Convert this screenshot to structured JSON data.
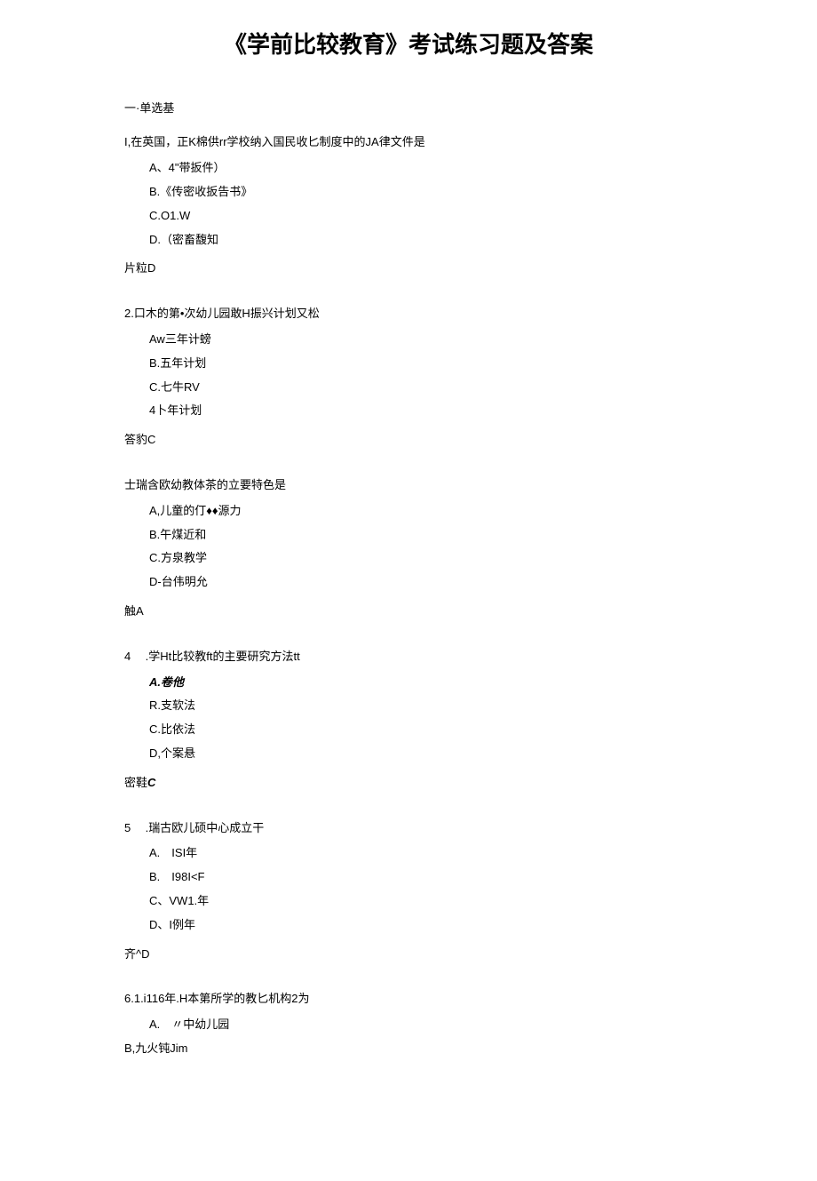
{
  "title": "《学前比较教育》考试练习题及答案",
  "section_heading": "一·单选基",
  "questions": [
    {
      "stem": "I,在英国，正K棉供rr学校纳入国民收匕制度中的JA律文件是",
      "options": [
        "A、4\"带扳件）",
        "B.《传密收扳告书》",
        "C.O1.W",
        "D.（密畜馥知"
      ],
      "answer_label": "片粒",
      "answer_value": "D"
    },
    {
      "stem": "2.口木的第•次幼儿园敢H振兴计划又松",
      "options": [
        "Aw三年计螃",
        "B.五年计划",
        "C.七牛RV",
        "4卜年计划"
      ],
      "answer_label": "答豹",
      "answer_value": "C"
    },
    {
      "stem": "士瑞含欧幼教体茶的立要特色是",
      "options": [
        "A,儿童的仃♦♦源力",
        "B.午煤近和",
        "C.方泉教学",
        "D-台伟明允"
      ],
      "answer_label": "触",
      "answer_value": "A"
    },
    {
      "stem_num": "4",
      "stem_text": ".学Ht比较教ft的主要研究方法tt",
      "options": [
        "A.卷他",
        "R.支软法",
        "C.比依法",
        "D,个案悬"
      ],
      "opt_bold_idx": 0,
      "answer_label": "密鞋",
      "answer_value": "C",
      "answer_italic": true
    },
    {
      "stem_num": "5",
      "stem_text": ".瑞古欧儿硕中心成立干",
      "options": [
        "A.　ISI年",
        "B.　I98I<F",
        "C、VW1.年",
        "D、I例年"
      ],
      "answer_label": "齐^",
      "answer_value": "D"
    },
    {
      "stem": "6.1.i116年.H本第所学的教匕机构2为",
      "options": [
        "A.　〃中幼儿园",
        "B,九火钝Jim"
      ],
      "answer_label": "",
      "answer_value": ""
    }
  ]
}
